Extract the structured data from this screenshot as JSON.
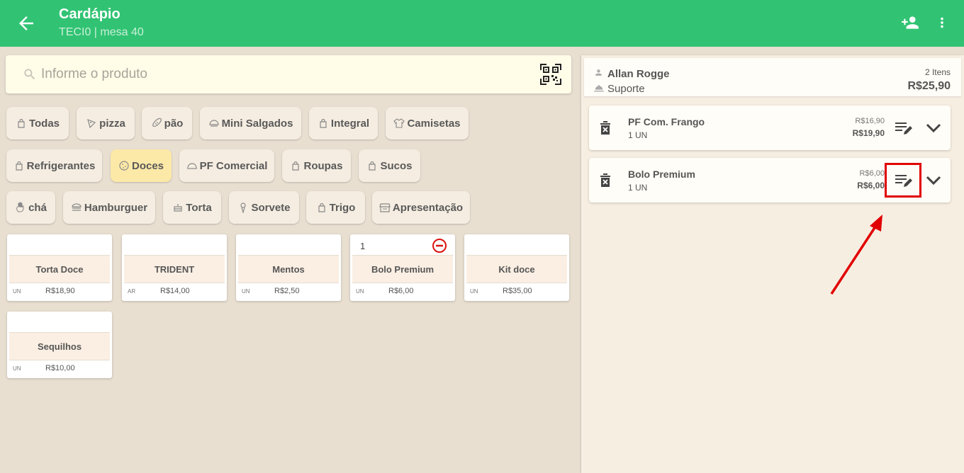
{
  "appbar": {
    "title": "Cardápio",
    "subtitle": "TECI0 | mesa 40",
    "color": "#31c373"
  },
  "search": {
    "placeholder": "Informe o produto"
  },
  "categories": [
    {
      "label": "Todas",
      "icon": "bag-icon",
      "active": false
    },
    {
      "label": "pizza",
      "icon": "pizza-icon",
      "active": false
    },
    {
      "label": "pão",
      "icon": "bread-icon",
      "active": false
    },
    {
      "label": "Mini Salgados",
      "icon": "snack-icon",
      "active": false
    },
    {
      "label": "Integral",
      "icon": "bag-icon",
      "active": false
    },
    {
      "label": "Camisetas",
      "icon": "shirt-icon",
      "active": false
    },
    {
      "label": "Refrigerantes",
      "icon": "bag-icon",
      "active": false
    },
    {
      "label": "Doces",
      "icon": "cookie-icon",
      "active": true
    },
    {
      "label": "PF Comercial",
      "icon": "cloche-icon",
      "active": false
    },
    {
      "label": "Roupas",
      "icon": "bag-icon",
      "active": false
    },
    {
      "label": "Sucos",
      "icon": "bag-icon",
      "active": false
    },
    {
      "label": "chá",
      "icon": "hand-icon",
      "active": false
    },
    {
      "label": "Hamburguer",
      "icon": "burger-icon",
      "active": false
    },
    {
      "label": "Torta",
      "icon": "cake-icon",
      "active": false
    },
    {
      "label": "Sorvete",
      "icon": "icecream-icon",
      "active": false
    },
    {
      "label": "Trigo",
      "icon": "bag-icon",
      "active": false
    },
    {
      "label": "Apresentação",
      "icon": "store-icon",
      "active": false
    }
  ],
  "products": [
    {
      "name": "Torta Doce",
      "unit": "UN",
      "price": "R$18,90",
      "qty": ""
    },
    {
      "name": "TRIDENT",
      "unit": "AR",
      "price": "R$14,00",
      "qty": ""
    },
    {
      "name": "Mentos",
      "unit": "UN",
      "price": "R$2,50",
      "qty": ""
    },
    {
      "name": "Bolo Premium",
      "unit": "UN",
      "price": "R$6,00",
      "qty": "1"
    },
    {
      "name": "Kit doce",
      "unit": "UN",
      "price": "R$35,00",
      "qty": ""
    },
    {
      "name": "Sequilhos",
      "unit": "UN",
      "price": "R$10,00",
      "qty": ""
    }
  ],
  "order": {
    "customer_name": "Allan Rogge",
    "customer_role": "Suporte",
    "item_count": "2 Itens",
    "total": "R$25,90",
    "items": [
      {
        "name": "PF Com. Frango",
        "qty": "1 UN",
        "old_price": "R$16,90",
        "price": "R$19,90"
      },
      {
        "name": "Bolo Premium",
        "qty": "1 UN",
        "old_price": "R$6,00",
        "price": "R$6,00"
      }
    ]
  },
  "colors": {
    "accent": "#31c373",
    "active_chip": "#fde9a7",
    "highlight": "#e10000"
  }
}
